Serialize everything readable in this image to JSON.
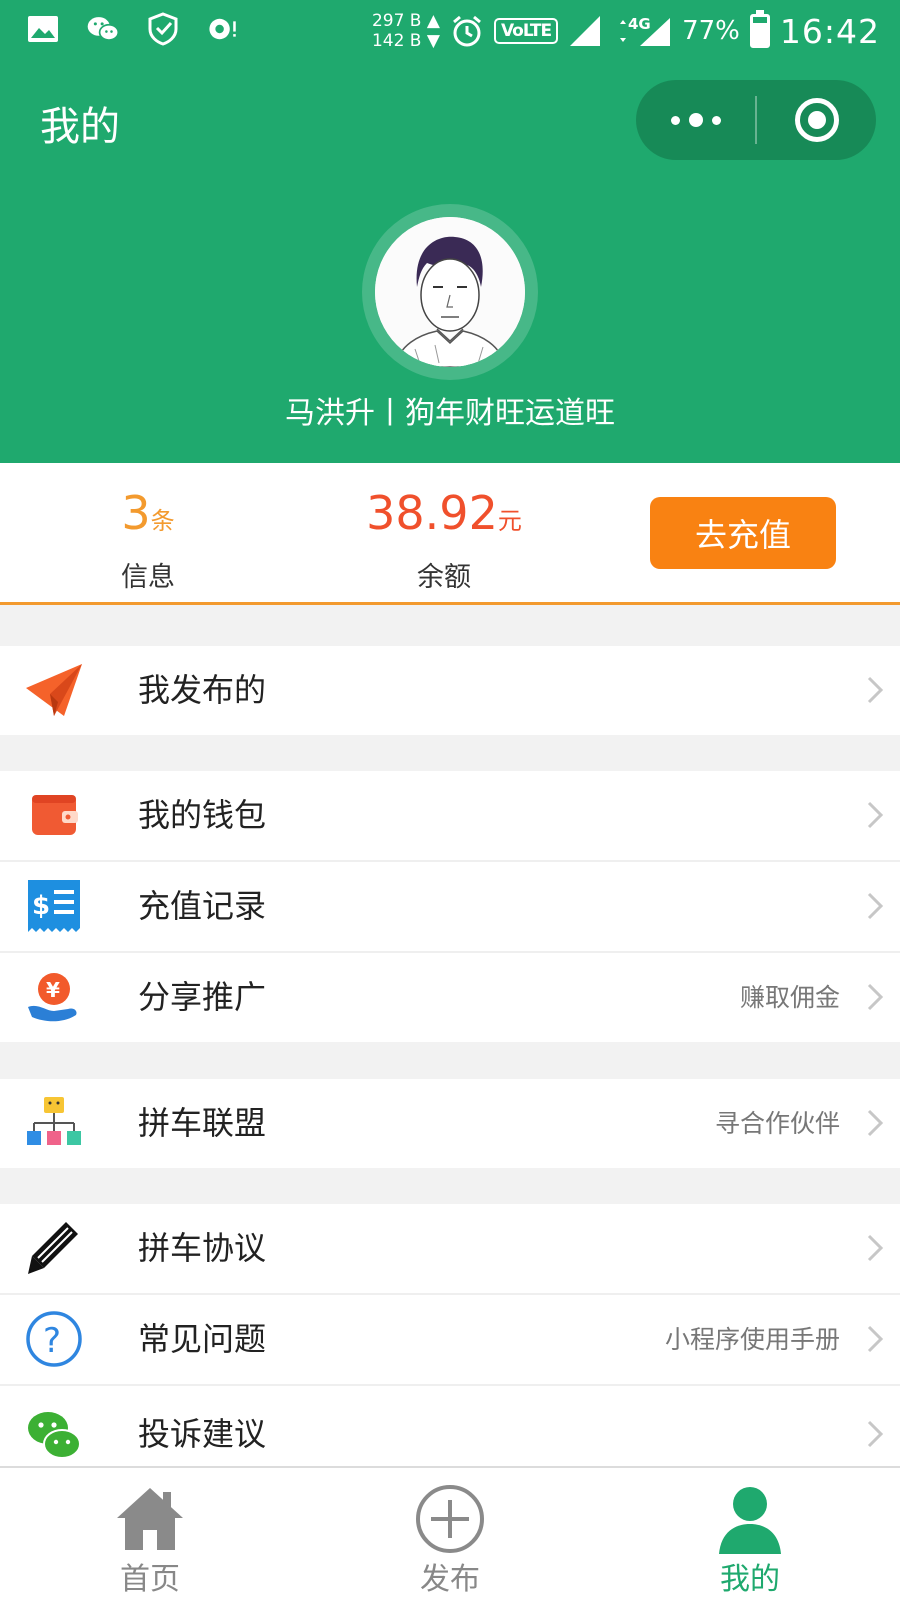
{
  "status_bar": {
    "net_up": "297 B",
    "net_down": "142 B",
    "volte": "VoLTE",
    "network": "4G",
    "battery": "77%",
    "battery_level": 0.77,
    "time": "16:42"
  },
  "header": {
    "title": "我的",
    "username": "马洪升丨狗年财旺运道旺"
  },
  "stats": {
    "messages": {
      "value": "3",
      "unit": "条",
      "label": "信息"
    },
    "balance": {
      "value": "38.92",
      "unit": "元",
      "label": "余额"
    },
    "recharge_label": "去充值"
  },
  "menu": {
    "published": {
      "label": "我发布的",
      "icon": "paper-plane-icon"
    },
    "wallet": {
      "label": "我的钱包",
      "icon": "wallet-icon"
    },
    "recharge_records": {
      "label": "充值记录",
      "icon": "receipt-icon"
    },
    "share": {
      "label": "分享推广",
      "hint": "赚取佣金",
      "icon": "yen-coin-hand-icon"
    },
    "carpool_alliance": {
      "label": "拼车联盟",
      "hint": "寻合作伙伴",
      "icon": "org-chart-icon"
    },
    "agreement": {
      "label": "拼车协议",
      "icon": "pencil-icon"
    },
    "faq": {
      "label": "常见问题",
      "hint": "小程序使用手册",
      "icon": "question-icon"
    },
    "feedback": {
      "label": "投诉建议",
      "icon": "wechat-icon"
    }
  },
  "tabbar": {
    "home": "首页",
    "publish": "发布",
    "mine": "我的"
  },
  "colors": {
    "primary_green": "#1fa96e",
    "accent_orange": "#f98212",
    "balance_red": "#f0502c"
  }
}
